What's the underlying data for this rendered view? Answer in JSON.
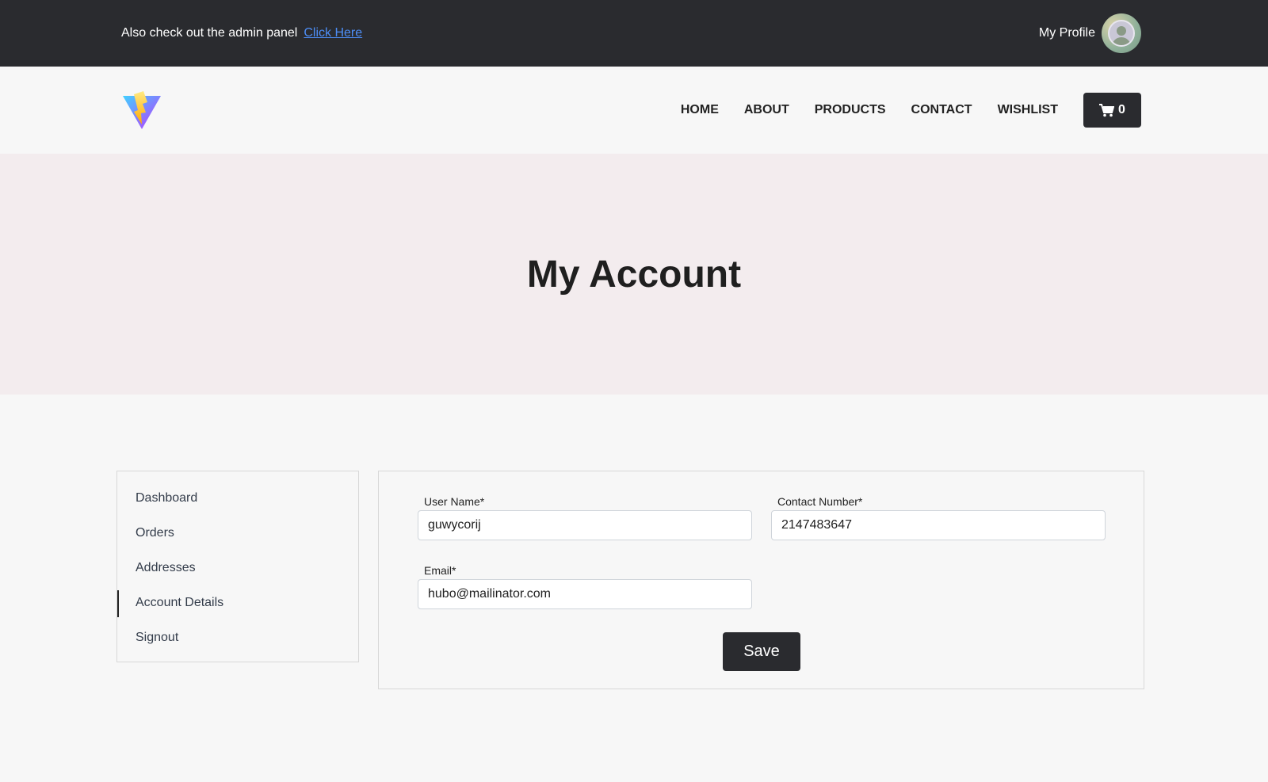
{
  "topbar": {
    "admin_text": "Also check out the admin panel",
    "admin_link": "Click Here",
    "profile_label": "My Profile"
  },
  "nav": {
    "items": [
      "HOME",
      "ABOUT",
      "PRODUCTS",
      "CONTACT",
      "WISHLIST"
    ],
    "cart_count": "0"
  },
  "hero": {
    "title": "My Account"
  },
  "sidebar": {
    "items": [
      "Dashboard",
      "Orders",
      "Addresses",
      "Account Details",
      "Signout"
    ],
    "active": "Account Details"
  },
  "form": {
    "username_label": "User Name*",
    "username_value": "guwycorij",
    "contact_label": "Contact Number*",
    "contact_value": "2147483647",
    "email_label": "Email*",
    "email_value": "hubo@mailinator.com",
    "save_label": "Save"
  },
  "colors": {
    "dark": "#2a2b2f",
    "link": "#4d8df5",
    "hero_bg": "#f3ecee",
    "page_bg": "#f7f7f7"
  },
  "icons": [
    "vite-logo-icon",
    "avatar-icon",
    "cart-icon"
  ]
}
